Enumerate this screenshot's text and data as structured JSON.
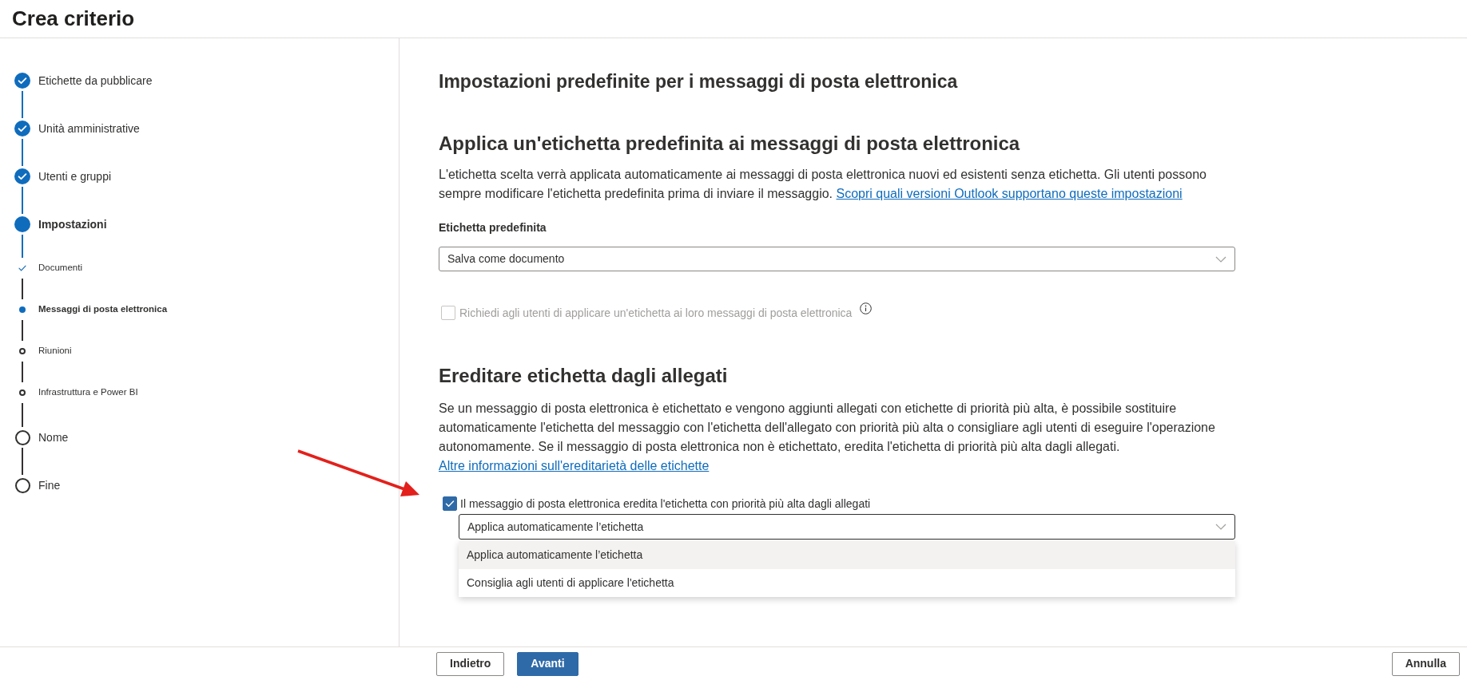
{
  "header": {
    "title": "Crea criterio"
  },
  "steps": [
    {
      "label": "Etichette da pubblicare",
      "completed": true,
      "current": false
    },
    {
      "label": "Unità amministrative",
      "completed": true,
      "current": false
    },
    {
      "label": "Utenti e gruppi",
      "completed": true,
      "current": false
    },
    {
      "label": "Impostazioni",
      "completed": false,
      "current": true,
      "children": [
        {
          "label": "Documenti",
          "completed": true,
          "current": false
        },
        {
          "label": "Messaggi di posta elettronica",
          "completed": false,
          "current": true
        },
        {
          "label": "Riunioni",
          "completed": false,
          "current": false
        },
        {
          "label": "Infrastruttura e Power BI",
          "completed": false,
          "current": false
        }
      ]
    },
    {
      "label": "Nome",
      "completed": false,
      "current": false
    },
    {
      "label": "Fine",
      "completed": false,
      "current": false
    }
  ],
  "page_title": "Impostazioni predefinite per i messaggi di posta elettronica",
  "default_label": {
    "heading": "Applica un'etichetta predefinita ai messaggi di posta elettronica",
    "description": "L'etichetta scelta verrà applicata automaticamente ai messaggi di posta elettronica nuovi ed esistenti senza etichetta. Gli utenti possono sempre modificare l'etichetta predefinita prima di inviare il messaggio.",
    "link": "Scopri quali versioni Outlook supportano queste impostazioni",
    "field_label": "Etichetta predefinita",
    "dropdown": {
      "value": "Salva come documento"
    },
    "require_checkbox": {
      "label": "Richiedi agli utenti di applicare un'etichetta ai loro messaggi di posta elettronica",
      "checked": false,
      "disabled": true
    }
  },
  "inherit": {
    "heading": "Ereditare etichetta dagli allegati",
    "description": "Se un messaggio di posta elettronica è etichettato e vengono aggiunti allegati con etichette di priorità più alta, è possibile sostituire automaticamente l'etichetta del messaggio con l'etichetta dell'allegato con priorità più alta o consigliare agli utenti di eseguire l'operazione autonomamente. Se il messaggio di posta elettronica non è etichettato, eredita l'etichetta di priorità più alta dagli allegati.",
    "link": "Altre informazioni sull'ereditarietà delle etichette",
    "checkbox": {
      "label": "Il messaggio di posta elettronica eredita l'etichetta con priorità più alta dagli allegati",
      "checked": true
    },
    "dropdown": {
      "value": "Applica automaticamente l’etichetta",
      "expanded": true,
      "options": [
        {
          "label": "Applica automaticamente l’etichetta",
          "selected": true
        },
        {
          "label": "Consiglia agli utenti di applicare l'etichetta",
          "selected": false
        }
      ]
    }
  },
  "footer": {
    "buttons": [
      {
        "label": "Indietro",
        "kind": "secondary"
      },
      {
        "label": "Avanti",
        "kind": "primary"
      }
    ],
    "cancel": {
      "label": "Annulla"
    }
  }
}
